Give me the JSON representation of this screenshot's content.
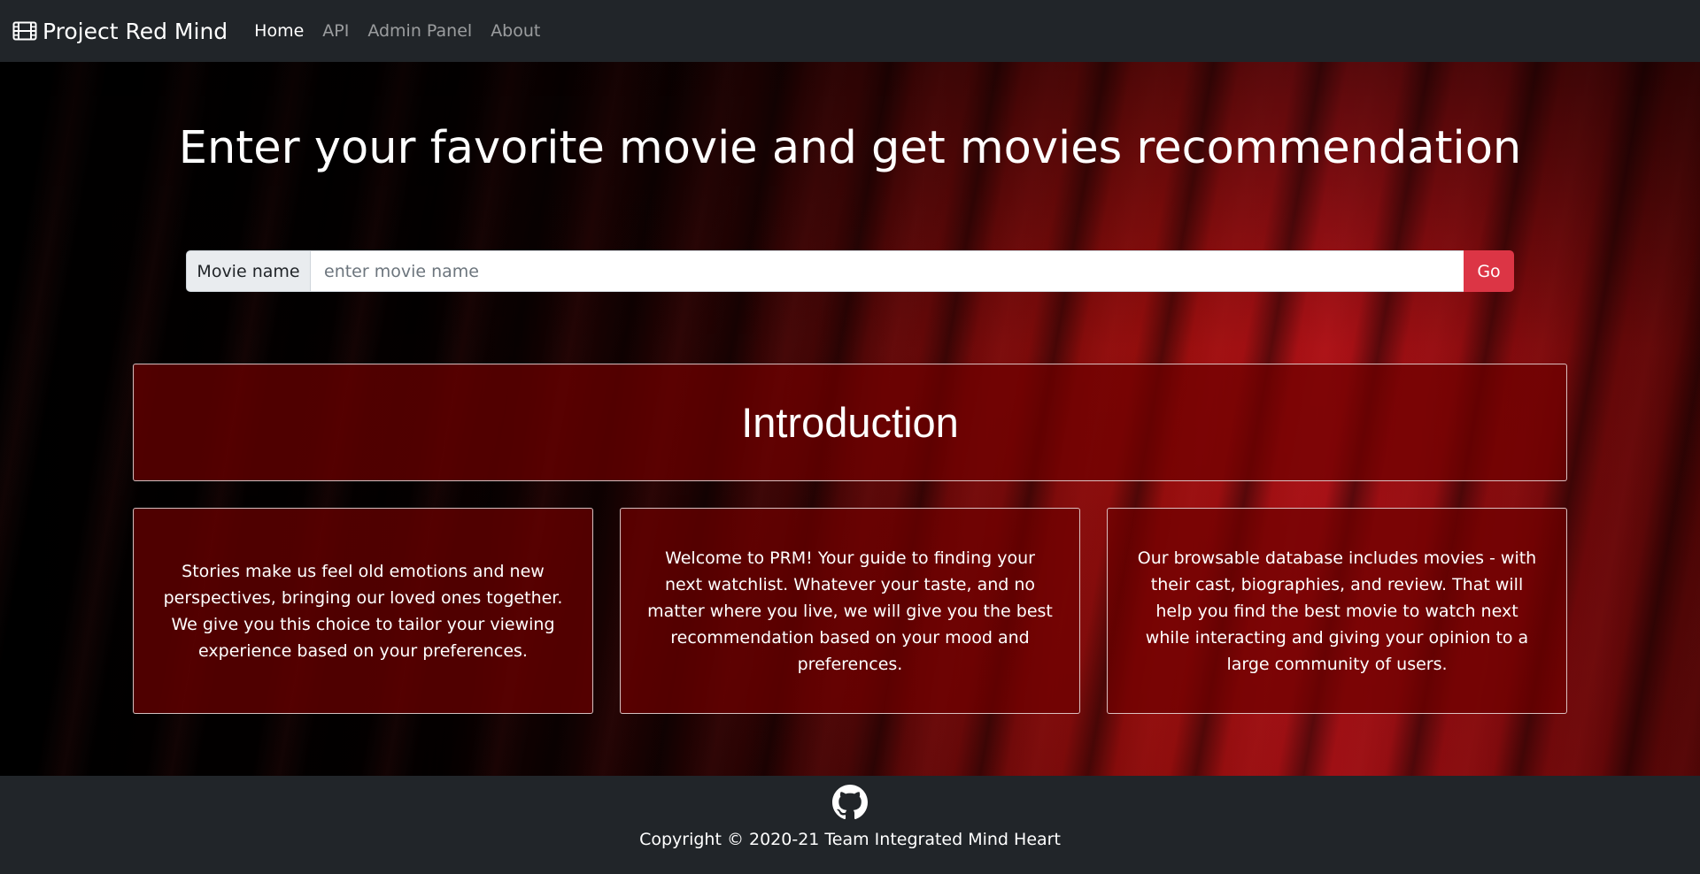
{
  "navbar": {
    "brand": "Project Red Mind",
    "brand_icon": "film-icon",
    "links": [
      {
        "label": "Home",
        "active": true
      },
      {
        "label": "API",
        "active": false
      },
      {
        "label": "Admin Panel",
        "active": false
      },
      {
        "label": "About",
        "active": false
      }
    ]
  },
  "hero": {
    "title": "Enter your favorite movie and get movies recommendation"
  },
  "search": {
    "label": "Movie name",
    "value": "",
    "placeholder": "enter movie name",
    "button_label": "Go",
    "button_color": "#dc3545"
  },
  "intro": {
    "title": "Introduction"
  },
  "cards": [
    {
      "text": "Stories make us feel old emotions and new perspectives, bringing our loved ones together. We give you this choice to tailor your viewing experience based on your preferences."
    },
    {
      "text": "Welcome to PRM! Your guide to finding your next watchlist. Whatever your taste, and no matter where you live, we will give you the best recommendation based on your mood and preferences."
    },
    {
      "text": "Our browsable database includes movies - with their cast, biographies, and review. That will help you find the best movie to watch next while interacting and giving your opinion to a large community of users."
    }
  ],
  "footer": {
    "icon": "github-icon",
    "copyright": "Copyright © 2020-21 Team Integrated Mind Heart"
  },
  "colors": {
    "navbar_bg": "#212529",
    "accent": "#dc3545",
    "card_bg": "#6e0000"
  }
}
